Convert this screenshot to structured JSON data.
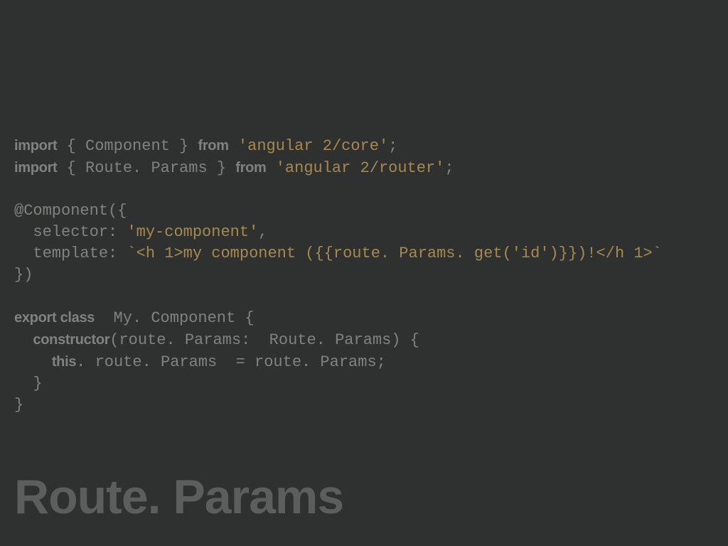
{
  "code": {
    "l1_import": "import",
    "l1_text1": " { Component } ",
    "l1_from": "from",
    "l1_text2": " ",
    "l1_str": "'angular 2/core'",
    "l1_text3": ";",
    "l2_import": "import",
    "l2_text1": " { Route. Params } ",
    "l2_from": "from",
    "l2_text2": " ",
    "l2_str": "'angular 2/router'",
    "l2_text3": ";",
    "l4": "@Component({",
    "l5a": "  selector: ",
    "l5str": "'my-component'",
    "l5b": ",",
    "l6a": "  template: ",
    "l6str": "`<h 1>my component ({{route. Params. get('id')}})!</h 1>`",
    "l7": "})",
    "l9a": "export class",
    "l9b": "  My. Component {",
    "l10a": "  ",
    "l10b": "constructor",
    "l10c": "(route. Params:  Route. Params) {",
    "l11a": "    ",
    "l11b": "this",
    "l11c": ". route. Params  = route. Params;",
    "l12": "  }",
    "l13": "}"
  },
  "title": "Route. Params"
}
